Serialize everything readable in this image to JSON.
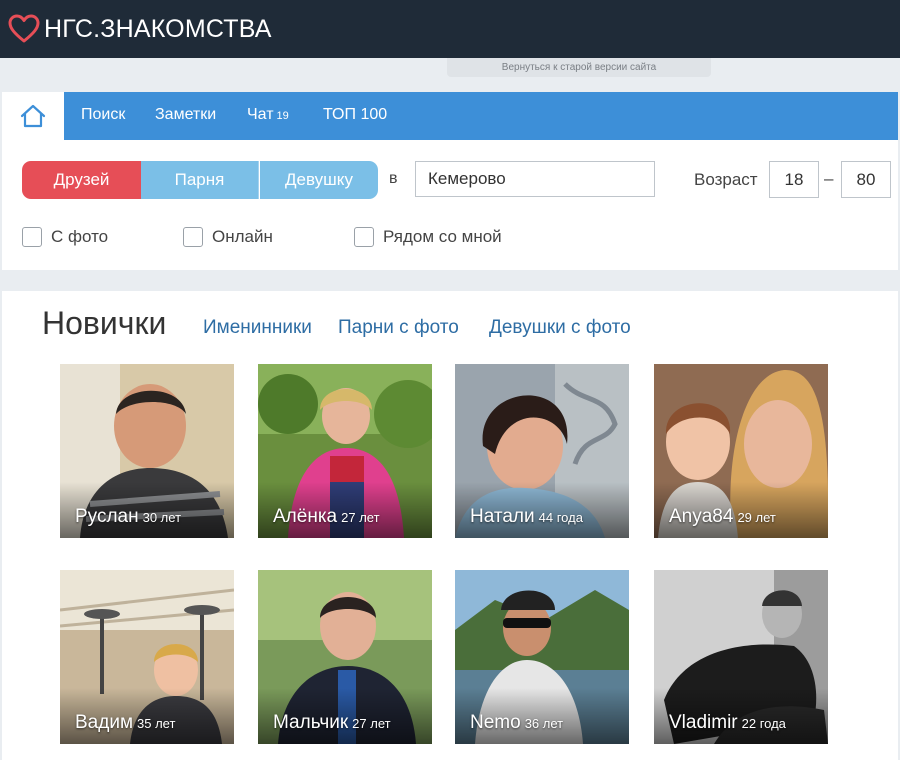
{
  "header": {
    "logo_text": "НГС.ЗНАКОМСТВА",
    "logo_color": "#e64e57",
    "bg_color": "#1f2b38"
  },
  "old_version_link": "Вернуться к старой версии сайта",
  "nav": {
    "home_icon": "home-icon",
    "items": [
      {
        "label": "Поиск"
      },
      {
        "label": "Заметки"
      },
      {
        "label": "Чат",
        "count": "19"
      },
      {
        "label": "ТОП 100"
      }
    ]
  },
  "search": {
    "seek_options": [
      "Друзей",
      "Парня",
      "Девушку"
    ],
    "selected": "Друзей",
    "in_label": "в",
    "city_value": "Кемерово",
    "age_label": "Возраст",
    "age_from": "18",
    "age_dash": "–",
    "age_to": "80",
    "checkboxes": [
      {
        "label": "С фото",
        "checked": false
      },
      {
        "label": "Онлайн",
        "checked": false
      },
      {
        "label": "Рядом со мной",
        "checked": false
      }
    ]
  },
  "section": {
    "title": "Новички",
    "links": [
      "Именинники",
      "Парни с фото",
      "Девушки с фото"
    ]
  },
  "profiles": [
    {
      "name": "Руслан",
      "age": "30 лет"
    },
    {
      "name": "Алёнка",
      "age": "27 лет"
    },
    {
      "name": "Натали",
      "age": "44 года"
    },
    {
      "name": "Anya84",
      "age": "29 лет"
    },
    {
      "name": "Вадим",
      "age": "35 лет"
    },
    {
      "name": "Мальчик",
      "age": "27 лет"
    },
    {
      "name": "Nemo",
      "age": "36 лет"
    },
    {
      "name": "Vladimir",
      "age": "22 года"
    }
  ],
  "colors": {
    "accent_red": "#e64e57",
    "nav_blue": "#3d8fd8",
    "seg_blue": "#7bbfe7",
    "link_blue": "#2e6da4"
  }
}
